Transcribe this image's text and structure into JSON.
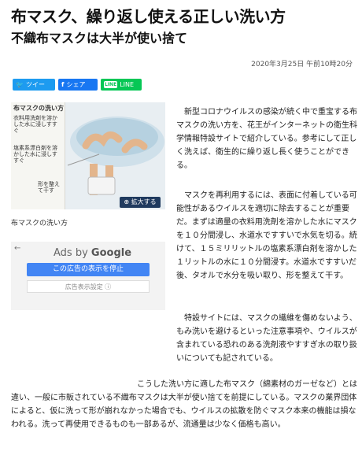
{
  "article": {
    "title": "布マスク、繰り返し使える正しい洗い方",
    "subtitle": "不織布マスクは大半が使い捨て",
    "date": "2020年3月25日 午前10時20分"
  },
  "share": {
    "twitter_label": "ツイート",
    "facebook_label": "シェア",
    "line_label": "LINEで送る",
    "line_icon_text": "LINE"
  },
  "figure": {
    "heading": "布マスクの洗い方",
    "step1": "衣料用洗剤を溶かした水に浸しすすぐ",
    "step2": "塩素系漂白剤を溶かした水に浸しすすぐ",
    "step3": "形を整えて干す",
    "zoom_label": "拡大する",
    "caption": "布マスクの洗い方"
  },
  "ad": {
    "ads_by": "Ads by",
    "google": "Google",
    "stop_label": "この広告の表示を停止",
    "why_label": "広告表示設定 ⓘ"
  },
  "paragraphs": {
    "p1": "新型コロナウイルスの感染が続く中で重宝する布マスクの洗い方を、花王がインターネットの衛生科学情報特設サイトで紹介している。参考にして正しく洗えば、衛生的に繰り返し長く使うことができる。",
    "p2": "マスクを再利用するには、表面に付着している可能性があるウイルスを適切に除去することが重要だ。まずは適量の衣料用洗剤を溶かした水にマスクを１０分間浸し、水道水ですすいで水気を切る。続けて、１５ミリリットルの塩素系漂白剤を溶かした１リットルの水に１０分間浸す。水道水ですすいだ後、タオルで水分を吸い取り、形を整えて干す。",
    "p3": "特設サイトには、マスクの繊維を傷めないよう、もみ洗いを避けるといった注意事項や、ウイルスが含まれている恐れのある洗剤液やすすぎ水の取り扱いについても記されている。",
    "p4": "こうした洗い方に適した布マスク（綿素材のガーゼなど）とは違い、一般に市販されている不織布マスクは大半が使い捨てを前提にしている。マスクの業界団体によると、仮に洗って形が崩れなかった場合でも、ウイルスの拡散を防ぐマスク本来の機能は損なわれる。洗って再使用できるものも一部あるが、流通量は少なく価格も高い。"
  }
}
